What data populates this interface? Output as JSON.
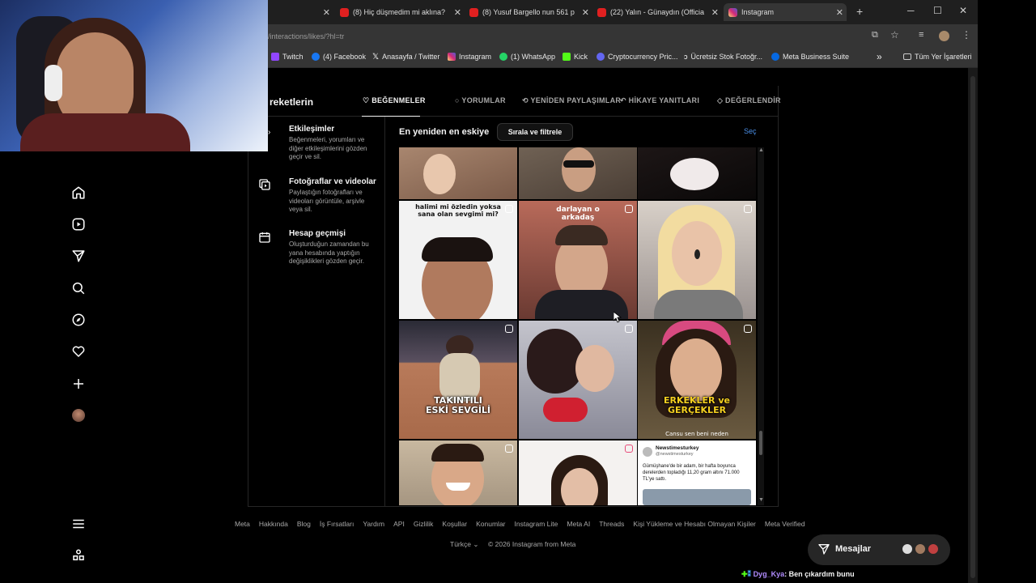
{
  "browser": {
    "tabs": [
      {
        "title": "(8) Hiç düşmedim mi aklına?",
        "color": "#e02020"
      },
      {
        "title": "(8) Yusuf Bargello nun 561 p",
        "color": "#e02020"
      },
      {
        "title": "(22) Yalın - Günaydın (Officia",
        "color": "#e02020"
      },
      {
        "title": "Instagram",
        "color": "#d62976"
      }
    ],
    "url": "/interactions/likes/?hl=tr",
    "bookmarks": [
      {
        "label": "Twitch",
        "color": "#9146ff"
      },
      {
        "label": "(4) Facebook",
        "color": "#1877f2"
      },
      {
        "label": "Anasayfa / Twitter",
        "color": "#ffffff"
      },
      {
        "label": "Instagram",
        "color": "#d62976"
      },
      {
        "label": "(1) WhatsApp",
        "color": "#25d366"
      },
      {
        "label": "Kick",
        "color": "#53fc18"
      },
      {
        "label": "Cryptocurrency Pric...",
        "color": "#6366f1"
      },
      {
        "label": "Ücretsiz Stok Fotoğr...",
        "color": "#ffffff"
      },
      {
        "label": "Meta Business Suite",
        "color": "#0668e1"
      }
    ],
    "bookmarks_more": "»",
    "all_bookmarks": "Tüm Yer İşaretleri"
  },
  "instagram": {
    "section_title": "reketlerin",
    "tabs": [
      "BEĞENMELER",
      "YORUMLAR",
      "YENİDEN PAYLAŞIMLAR",
      "HİKAYE YANITLARI",
      "DEĞERLENDİR"
    ],
    "menu": [
      {
        "title": "Etkileşimler",
        "desc": "Beğenmeleri, yorumları ve diğer etkileşimlerini gözden geçir ve sil."
      },
      {
        "title": "Fotoğraflar ve videolar",
        "desc": "Paylaştığın fotoğrafları ve videoları görüntüle, arşivle veya sil."
      },
      {
        "title": "Hesap geçmişi",
        "desc": "Oluşturduğun zamandan bu yana hesabında yaptığın değişiklikleri gözden geçir."
      }
    ],
    "sort_label": "En yeniden en eskiye",
    "filter_button": "Sırala ve filtrele",
    "select_link": "Seç",
    "thumb_captions": {
      "t1": "halimi mi özledin yoksa sana olan sevgimi mi?",
      "t2": "darlayan o arkadaş",
      "t3": "TAKINTILI ESKİ SEVGİLİ",
      "t4": "ERKEKLER ve GERÇEKLER",
      "t4b": "Cansu sen beni neden",
      "t5_account": "Newstimesturkey",
      "t5_handle": "@newstimesturkey",
      "t5_text": "Gümüşhane'de bir adam, bir hafta boyunca derelerden topladığı 11,20 gram altını 71.000 TL'ye sattı."
    },
    "footer_links": [
      "Meta",
      "Hakkında",
      "Blog",
      "İş Fırsatları",
      "Yardım",
      "API",
      "Gizlilik",
      "Koşullar",
      "Konumlar",
      "Instagram Lite",
      "Meta AI",
      "Threads",
      "Kişi Yükleme ve Hesabı Olmayan Kişiler",
      "Meta Verified"
    ],
    "language": "Türkçe",
    "copyright": "© 2026 Instagram from Meta",
    "messages_label": "Mesajlar"
  },
  "stream_chat": {
    "user": "Dyg_Kya",
    "message": ": Ben çıkardım bunu"
  }
}
